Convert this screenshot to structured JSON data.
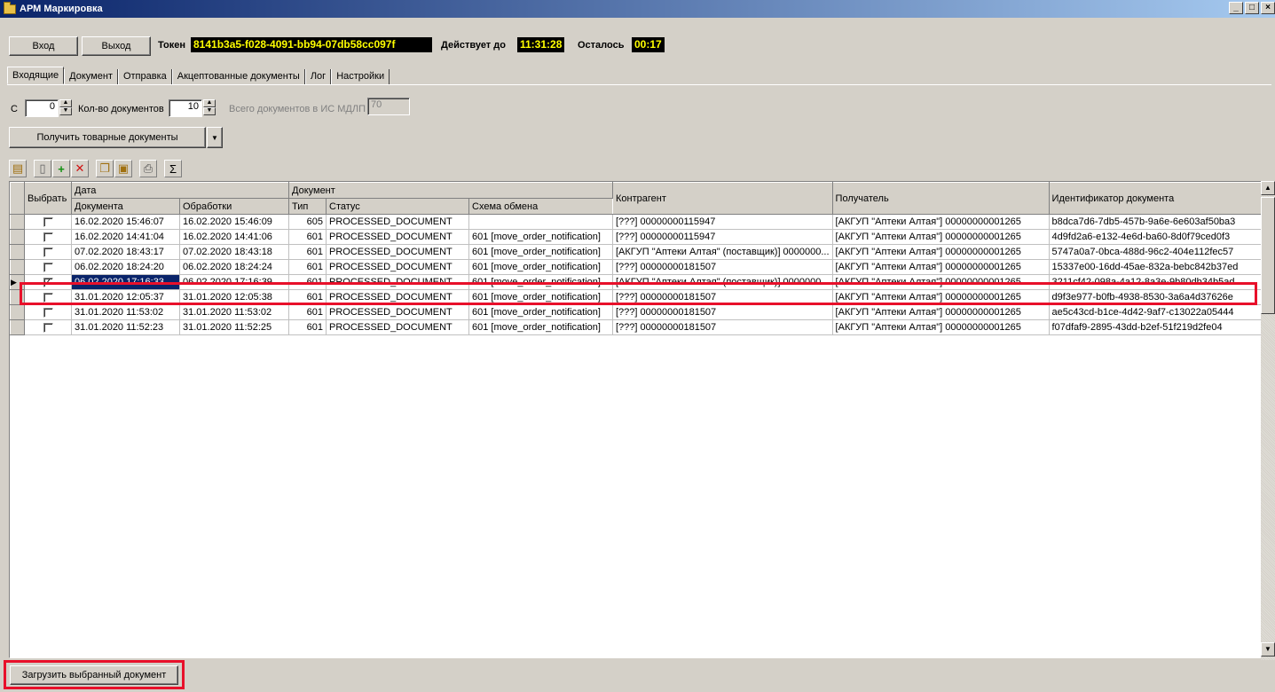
{
  "window": {
    "title": "АРМ Маркировка"
  },
  "header": {
    "login_label": "Вход",
    "exit_label": "Выход",
    "token_label": "Токен",
    "token_value": "8141b3a5-f028-4091-bb94-07db58cc097f",
    "valid_until_label": "Действует до",
    "valid_until_value": "11:31:28",
    "remaining_label": "Осталось",
    "remaining_value": "00:17"
  },
  "tabs": [
    {
      "label": "Входящие",
      "active": true
    },
    {
      "label": "Документ"
    },
    {
      "label": "Отправка"
    },
    {
      "label": "Акцептованные документы"
    },
    {
      "label": "Лог"
    },
    {
      "label": "Настройки"
    }
  ],
  "filters": {
    "from_label": "С",
    "from_value": "0",
    "count_label": "Кол-во документов",
    "count_value": "10",
    "total_label": "Всего документов в ИС МДЛП",
    "total_value": "70"
  },
  "get_docs_button": "Получить товарные документы",
  "grid": {
    "group_headers": {
      "select": "Выбрать",
      "date": "Дата",
      "document": "Документ"
    },
    "columns": {
      "doc_date": "Документа",
      "processed": "Обработки",
      "type": "Тип",
      "status": "Статус",
      "scheme": "Схема обмена",
      "counterparty": "Контрагент",
      "recipient": "Получатель",
      "doc_id": "Идентификатор документа"
    },
    "rows": [
      {
        "checked": false,
        "doc_date": "16.02.2020 15:46:07",
        "processed": "16.02.2020 15:46:09",
        "type": "605",
        "status": "PROCESSED_DOCUMENT",
        "scheme": "",
        "counterparty": "[???] 00000000115947",
        "recipient": "[АКГУП \"Аптеки Алтая\"] 00000000001265",
        "doc_id": "b8dca7d6-7db5-457b-9a6e-6e603af50ba3"
      },
      {
        "checked": false,
        "doc_date": "16.02.2020 14:41:04",
        "processed": "16.02.2020 14:41:06",
        "type": "601",
        "status": "PROCESSED_DOCUMENT",
        "scheme": "601 [move_order_notification]",
        "counterparty": "[???] 00000000115947",
        "recipient": "[АКГУП \"Аптеки Алтая\"] 00000000001265",
        "doc_id": "4d9fd2a6-e132-4e6d-ba60-8d0f79ced0f3"
      },
      {
        "checked": false,
        "doc_date": "07.02.2020 18:43:17",
        "processed": "07.02.2020 18:43:18",
        "type": "601",
        "status": "PROCESSED_DOCUMENT",
        "scheme": "601 [move_order_notification]",
        "counterparty": "[АКГУП \"Аптеки Алтая\" (поставщик)] 0000000...",
        "recipient": "[АКГУП \"Аптеки Алтая\"] 00000000001265",
        "doc_id": "5747a0a7-0bca-488d-96c2-404e112fec57"
      },
      {
        "checked": false,
        "doc_date": "06.02.2020 18:24:20",
        "processed": "06.02.2020 18:24:24",
        "type": "601",
        "status": "PROCESSED_DOCUMENT",
        "scheme": "601 [move_order_notification]",
        "counterparty": "[???] 00000000181507",
        "recipient": "[АКГУП \"Аптеки Алтая\"] 00000000001265",
        "doc_id": "15337e00-16dd-45ae-832a-bebc842b37ed"
      },
      {
        "checked": true,
        "selected": true,
        "doc_date": "06.02.2020 17:16:33",
        "processed": "06.02.2020 17:16:39",
        "type": "601",
        "status": "PROCESSED_DOCUMENT",
        "scheme": "601 [move_order_notification]",
        "counterparty": "[АКГУП \"Аптеки Алтая\" (поставщик)] 0000000...",
        "recipient": "[АКГУП \"Аптеки Алтая\"] 00000000001265",
        "doc_id": "3211cf42-098a-4a12-8a3e-9b80db34b5ad"
      },
      {
        "checked": false,
        "doc_date": "31.01.2020 12:05:37",
        "processed": "31.01.2020 12:05:38",
        "type": "601",
        "status": "PROCESSED_DOCUMENT",
        "scheme": "601 [move_order_notification]",
        "counterparty": "[???] 00000000181507",
        "recipient": "[АКГУП \"Аптеки Алтая\"] 00000000001265",
        "doc_id": "d9f3e977-b0fb-4938-8530-3a6a4d37626e"
      },
      {
        "checked": false,
        "doc_date": "31.01.2020 11:53:02",
        "processed": "31.01.2020 11:53:02",
        "type": "601",
        "status": "PROCESSED_DOCUMENT",
        "scheme": "601 [move_order_notification]",
        "counterparty": "[???] 00000000181507",
        "recipient": "[АКГУП \"Аптеки Алтая\"] 00000000001265",
        "doc_id": "ae5c43cd-b1ce-4d42-9af7-c13022a05444"
      },
      {
        "checked": false,
        "doc_date": "31.01.2020 11:52:23",
        "processed": "31.01.2020 11:52:25",
        "type": "601",
        "status": "PROCESSED_DOCUMENT",
        "scheme": "601 [move_order_notification]",
        "counterparty": "[???] 00000000181507",
        "recipient": "[АКГУП \"Аптеки Алтая\"] 00000000001265",
        "doc_id": "f07dfaf9-2895-43dd-b2ef-51f219d2fe04"
      }
    ]
  },
  "load_button": "Загрузить выбранный документ",
  "icons": [
    "folder-icon",
    "properties-icon",
    "new-doc-icon",
    "add-icon",
    "delete-icon",
    "copy-icon",
    "paste-icon",
    "print-icon",
    "sum-icon"
  ],
  "colors": {
    "highlight": "#e8102a",
    "token_bg": "#000000",
    "token_fg": "#ffff00",
    "selection": "#0a246a"
  }
}
